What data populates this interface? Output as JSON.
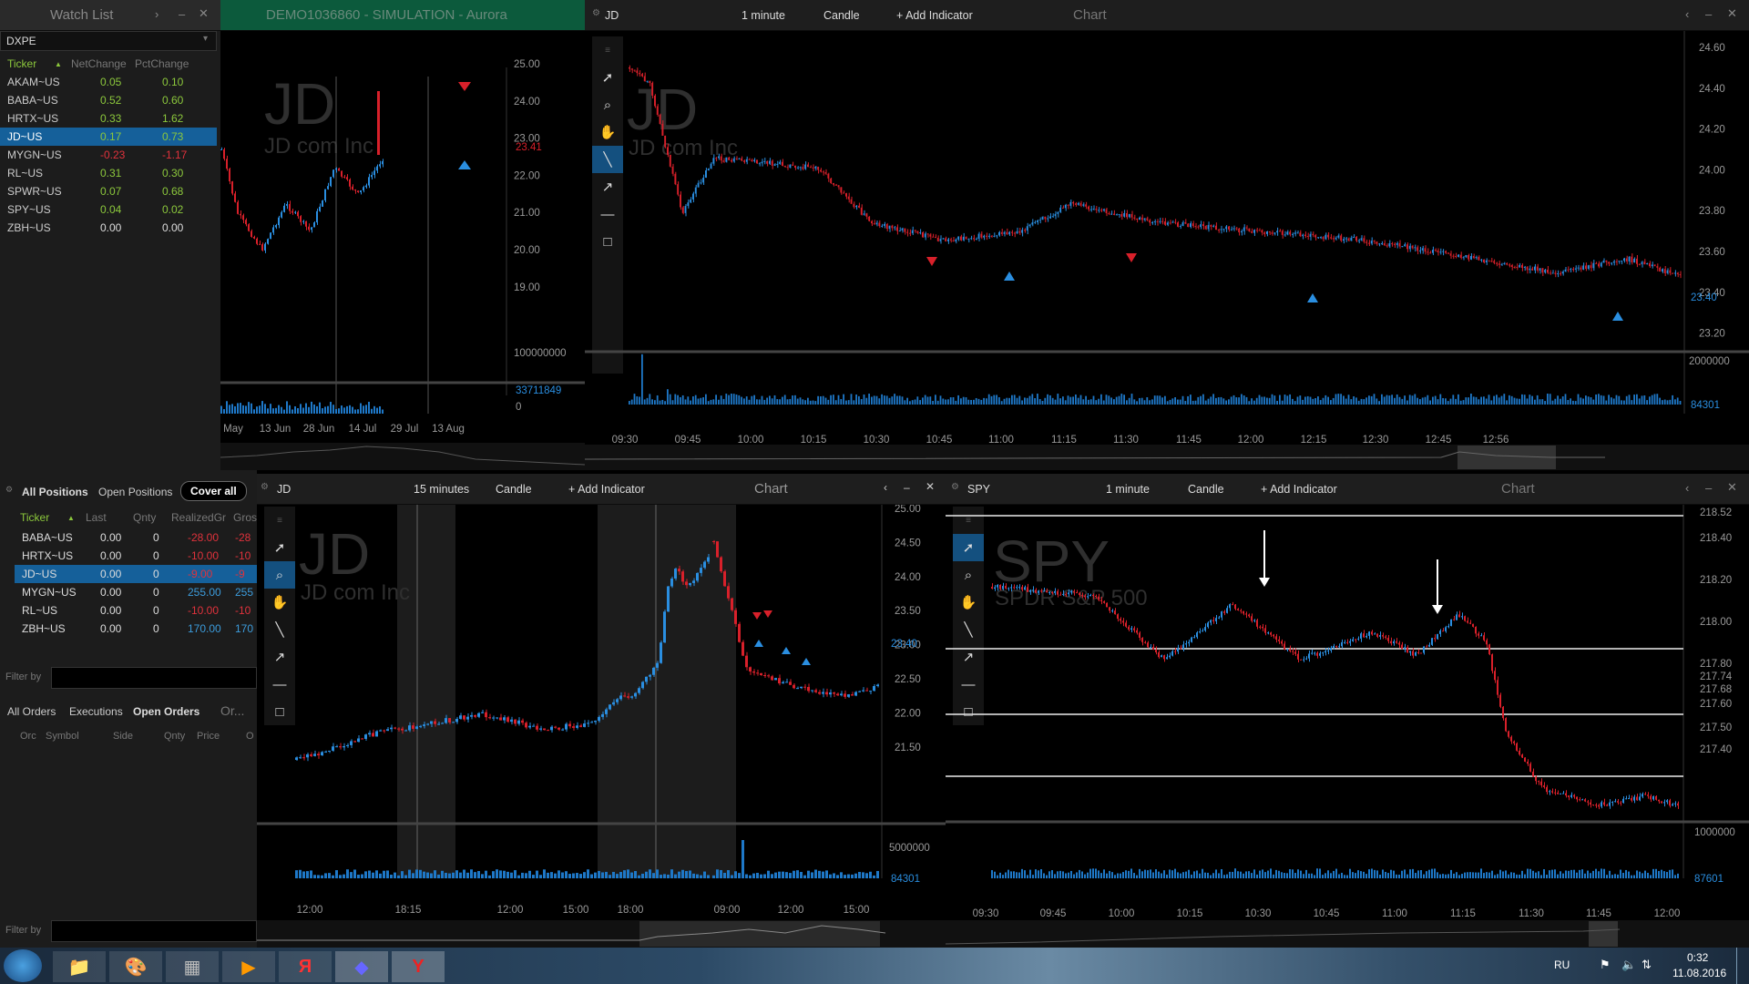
{
  "watchlist": {
    "title": "Watch List",
    "list": "DXPE",
    "cols": [
      "Ticker",
      "NetChange",
      "PctChange"
    ],
    "rows": [
      [
        "AKAM~US",
        "0.05",
        "0.10"
      ],
      [
        "BABA~US",
        "0.52",
        "0.60"
      ],
      [
        "HRTX~US",
        "0.33",
        "1.62"
      ],
      [
        "JD~US",
        "0.17",
        "0.73"
      ],
      [
        "MYGN~US",
        "-0.23",
        "-1.17"
      ],
      [
        "RL~US",
        "0.31",
        "0.30"
      ],
      [
        "SPWR~US",
        "0.07",
        "0.68"
      ],
      [
        "SPY~US",
        "0.04",
        "0.02"
      ],
      [
        "ZBH~US",
        "0.00",
        "0.00"
      ]
    ]
  },
  "account": {
    "title": "DEMO1036860 - SIMULATION - Aurora"
  },
  "mini": {
    "sym": "JD",
    "name": "JD com Inc",
    "prices": [
      "25.00",
      "24.00",
      "23.00",
      "22.00",
      "21.00",
      "20.00",
      "19.00"
    ],
    "last": "23.41",
    "vol_top": "100000000",
    "vol_last": "33711849",
    "vol_zero": "0",
    "dates": [
      "May",
      "13 Jun",
      "28 Jun",
      "14 Jul",
      "29 Jul",
      "13 Aug"
    ]
  },
  "c1": {
    "sym": "JD",
    "interval": "1 minute",
    "type": "Candle",
    "add": "+ Add Indicator",
    "title": "Chart",
    "name": "JD com Inc",
    "prices": [
      "24.60",
      "24.40",
      "24.20",
      "24.00",
      "23.80",
      "23.60",
      "23.40",
      "23.20"
    ],
    "last": "23.40",
    "vol_top": "2000000",
    "vol_last": "84301",
    "times": [
      "09:30",
      "09:45",
      "10:00",
      "10:15",
      "10:30",
      "10:45",
      "11:00",
      "11:15",
      "11:30",
      "11:45",
      "12:00",
      "12:15",
      "12:30",
      "12:45",
      "12:56"
    ]
  },
  "positions": {
    "tabs": [
      "All Positions",
      "Open Positions"
    ],
    "cover": "Cover all",
    "cols": [
      "Ticker",
      "Last",
      "Qnty",
      "RealizedGr",
      "Gros"
    ],
    "rows": [
      [
        "BABA~US",
        "0.00",
        "0",
        "-28.00",
        "-28"
      ],
      [
        "HRTX~US",
        "0.00",
        "0",
        "-10.00",
        "-10"
      ],
      [
        "JD~US",
        "0.00",
        "0",
        "-9.00",
        "-9"
      ],
      [
        "MYGN~US",
        "0.00",
        "0",
        "255.00",
        "255"
      ],
      [
        "RL~US",
        "0.00",
        "0",
        "-10.00",
        "-10"
      ],
      [
        "ZBH~US",
        "0.00",
        "0",
        "170.00",
        "170"
      ]
    ],
    "filter": "Filter by"
  },
  "orders": {
    "tabs": [
      "All Orders",
      "Executions",
      "Open Orders",
      "Or..."
    ],
    "cols": [
      "Orc",
      "Symbol",
      "Side",
      "Qnty",
      "Price",
      "O"
    ],
    "filter": "Filter by"
  },
  "c2": {
    "sym": "JD",
    "interval": "15 minutes",
    "type": "Candle",
    "add": "+ Add Indicator",
    "title": "Chart",
    "name": "JD com Inc",
    "prices": [
      "25.00",
      "24.50",
      "24.00",
      "23.50",
      "23.00",
      "22.50",
      "22.00",
      "21.50"
    ],
    "last": "23.40",
    "vol_top": "5000000",
    "vol_last": "84301",
    "times": [
      "12:00",
      "18:15",
      "12:00",
      "15:00",
      "18:00",
      "09:00",
      "12:00",
      "15:00"
    ]
  },
  "c3": {
    "sym": "SPY",
    "interval": "1 minute",
    "type": "Candle",
    "add": "+ Add Indicator",
    "title": "Chart",
    "name": "SPDR S&P 500",
    "prices": [
      "218.52",
      "218.40",
      "218.20",
      "218.00",
      "217.80",
      "217.74",
      "217.68",
      "217.60",
      "217.50",
      "217.40"
    ],
    "vol_top": "1000000",
    "vol_last": "87601",
    "times": [
      "09:30",
      "09:45",
      "10:00",
      "10:15",
      "10:30",
      "10:45",
      "11:00",
      "11:15",
      "11:30",
      "11:45",
      "12:00"
    ]
  },
  "taskbar": {
    "lang": "RU",
    "time": "0:32",
    "date": "11.08.2016"
  },
  "colors": {
    "up": "#2a8ee0",
    "down": "#d8202a",
    "panel": "#1e1e1e",
    "select": "#15609a"
  }
}
